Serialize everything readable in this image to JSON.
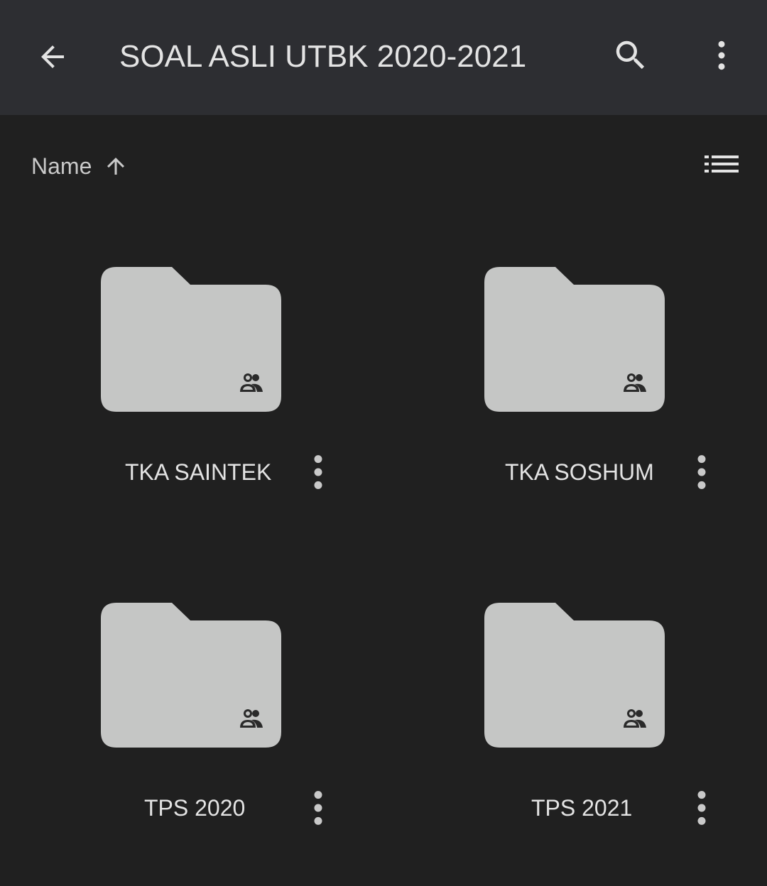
{
  "appbar": {
    "title": "SOAL ASLI UTBK 2020-2021",
    "back_icon": "arrow-back-icon",
    "search_icon": "search-icon",
    "more_icon": "more-vert-icon",
    "background": "#2d2e32"
  },
  "sort": {
    "label": "Name",
    "direction_icon": "arrow-upward-icon",
    "view_icon": "list-view-icon"
  },
  "folders": [
    {
      "name": "TKA SAINTEK",
      "shared": true
    },
    {
      "name": "TKA SOSHUM",
      "shared": true
    },
    {
      "name": "TPS 2020",
      "shared": true
    },
    {
      "name": "TPS 2021",
      "shared": true
    }
  ],
  "colors": {
    "background": "#202020",
    "folder": "#c5c6c5",
    "text": "#e3e3e3",
    "icon": "#e3e3e3"
  }
}
